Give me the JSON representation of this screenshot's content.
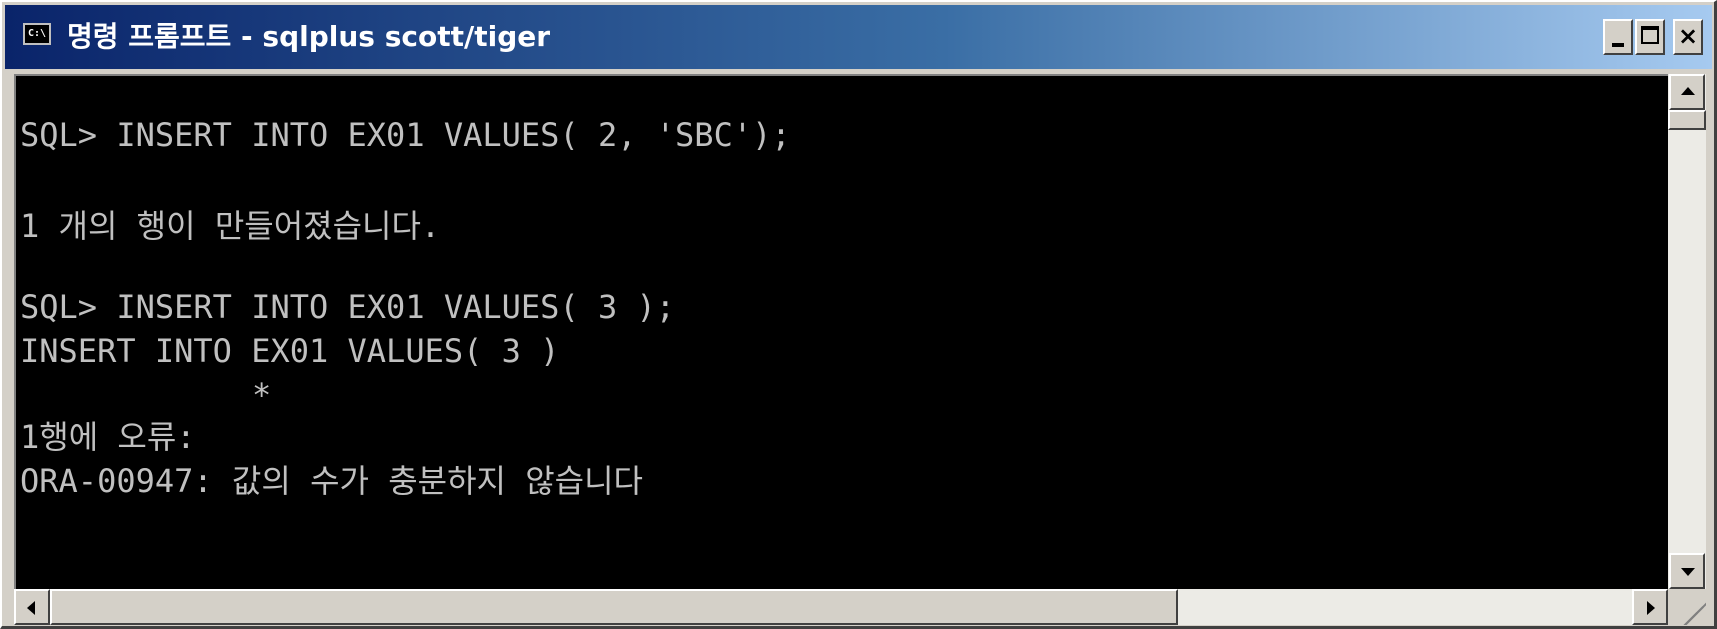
{
  "window": {
    "icon_text": "C:\\",
    "title": "명령 프롬프트 - sqlplus scott/tiger",
    "controls": {
      "minimize": "minimize",
      "maximize": "maximize",
      "close": "×"
    }
  },
  "console": {
    "lines": [
      "SQL> INSERT INTO EX01 VALUES( 2, 'SBC');",
      "1 개의 행이 만들어졌습니다.",
      "SQL> INSERT INTO EX01 VALUES( 3 );",
      "INSERT INTO EX01 VALUES( 3 )",
      "*",
      "1행에 오류:",
      "ORA-00947: 값의 수가 충분하지 않습니다"
    ]
  },
  "scrollbars": {
    "vertical": "vertical-scrollbar",
    "horizontal": "horizontal-scrollbar"
  },
  "colors": {
    "console_bg": "#000000",
    "console_text": "#c0c0c0",
    "titlebar_start": "#0a246a",
    "titlebar_end": "#a6caf0"
  }
}
